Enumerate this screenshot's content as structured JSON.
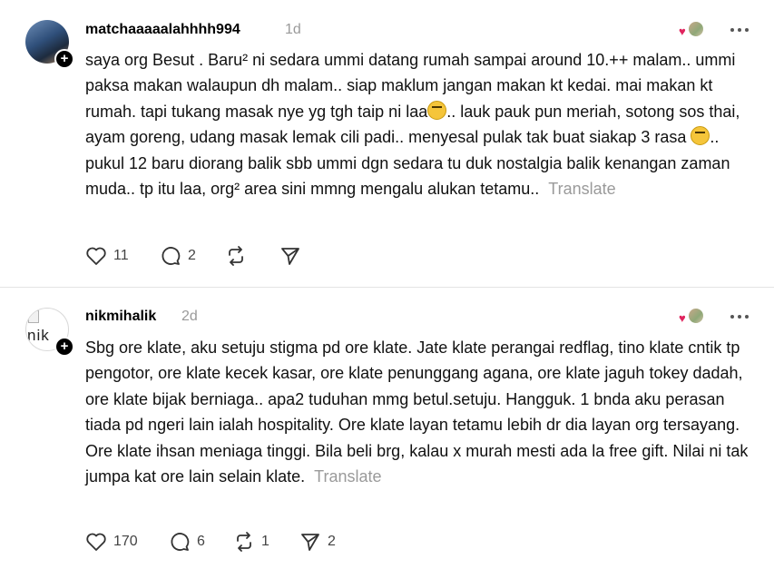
{
  "posts": [
    {
      "username": "matchaaaaalahhhh994",
      "time": "1d",
      "text": "saya org Besut . Baru² ni sedara ummi datang rumah sampai around 10.++ malam.. ummi paksa makan walaupun dh malam.. siap maklum jangan makan kt kedai. mai makan kt rumah. tapi tukang masak nye yg tgh taip ni laa",
      "text_2": ".. lauk pauk pun meriah, sotong sos thai, ayam goreng, udang masak lemak cili padi.. menyesal pulak tak buat siakap 3 rasa ",
      "text_3": ".. pukul 12 baru diorang balik sbb ummi dgn sedara tu duk nostalgia balik kenangan zaman muda.. tp itu laa, org² area sini mmng mengalu alukan tetamu..",
      "translate_label": "Translate",
      "likes": "11",
      "replies": "2",
      "reposts": "",
      "shares": ""
    },
    {
      "username": "nikmihalik",
      "time": "2d",
      "avatar_alt": "nik",
      "text": "Sbg ore klate, aku setuju stigma pd ore klate. Jate klate perangai redflag, tino klate cntik tp pengotor, ore klate kecek kasar, ore klate penunggang agana, ore klate jaguh tokey dadah, ore klate bijak berniaga.. apa2 tuduhan mmg betul.setuju. Hangguk. 1 bnda aku perasan tiada pd ngeri lain ialah hospitality. Ore klate layan tetamu lebih dr dia layan org tersayang. Ore klate ihsan meniaga tinggi. Bila beli brg, kalau x murah mesti ada la free gift. Nilai ni tak jumpa kat ore lain selain klate.",
      "translate_label": "Translate",
      "likes": "170",
      "replies": "6",
      "reposts": "1",
      "shares": "2"
    }
  ],
  "colors": {
    "liked_heart": "#e0245e",
    "muted": "#9a9a9a",
    "follow_badge": "#000000"
  }
}
